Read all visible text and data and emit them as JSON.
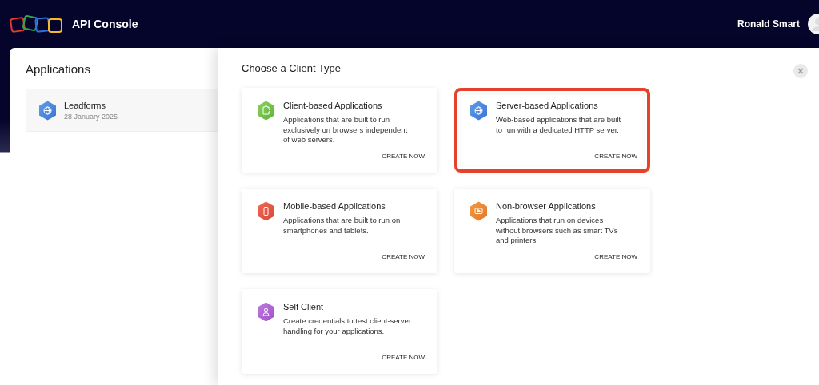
{
  "header": {
    "title": "API Console",
    "user_name": "Ronald Smart"
  },
  "applications_panel": {
    "title": "Applications",
    "items": [
      {
        "name": "Leadforms",
        "date": "28 January 2025",
        "kind": "server"
      }
    ]
  },
  "client_type_panel": {
    "title": "Choose a Client Type",
    "cards": [
      {
        "kind": "client",
        "title": "Client-based Applications",
        "description": "Applications that are built to run exclusively on browsers independent of web servers.",
        "action": "CREATE NOW",
        "highlighted": false
      },
      {
        "kind": "server",
        "title": "Server-based Applications",
        "description": "Web-based applications that are built to run with a dedicated HTTP server.",
        "action": "CREATE NOW",
        "highlighted": true
      },
      {
        "kind": "mobile",
        "title": "Mobile-based Applications",
        "description": "Applications that are built to run on smartphones and tablets.",
        "action": "CREATE NOW",
        "highlighted": false
      },
      {
        "kind": "nonbrowser",
        "title": "Non-browser Applications",
        "description": "Applications that run on devices without browsers such as smart TVs and printers.",
        "action": "CREATE NOW",
        "highlighted": false
      },
      {
        "kind": "self",
        "title": "Self Client",
        "description": "Create credentials to test client-server handling for your applications.",
        "action": "CREATE NOW",
        "highlighted": false
      }
    ]
  }
}
